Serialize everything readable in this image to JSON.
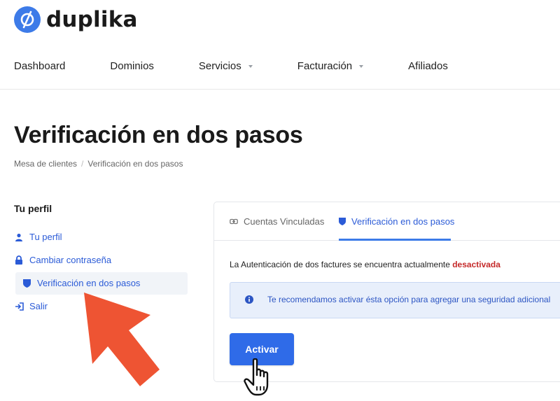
{
  "brand": {
    "name": "duplika",
    "color": "#3d7be8"
  },
  "nav": {
    "items": [
      {
        "label": "Dashboard",
        "has_dropdown": false
      },
      {
        "label": "Dominios",
        "has_dropdown": false
      },
      {
        "label": "Servicios",
        "has_dropdown": true
      },
      {
        "label": "Facturación",
        "has_dropdown": true
      },
      {
        "label": "Afiliados",
        "has_dropdown": false
      }
    ]
  },
  "page": {
    "title": "Verificación en dos pasos",
    "breadcrumb": [
      "Mesa de clientes",
      "/",
      "Verificación en dos pasos"
    ]
  },
  "sidebar": {
    "heading": "Tu perfil",
    "items": [
      {
        "label": "Tu perfil",
        "icon": "user-icon"
      },
      {
        "label": "Cambiar contraseña",
        "icon": "lock-icon"
      },
      {
        "label": "Verificación en dos pasos",
        "icon": "shield-icon",
        "active": true
      },
      {
        "label": "Salir",
        "icon": "logout-icon"
      }
    ]
  },
  "tabs": [
    {
      "label": "Cuentas Vinculadas",
      "icon": "link-icon",
      "active": false
    },
    {
      "label": "Verificación en dos pasos",
      "icon": "shield-icon",
      "active": true
    }
  ],
  "content": {
    "status_prefix": "La Autenticación de dos factures se encuentra actualmente ",
    "status_value": "desactivada",
    "alert_text": "Te recomendamos activar ésta opción para agregar una seguridad adicional",
    "activate_label": "Activar"
  },
  "colors": {
    "accent": "#2f6be8",
    "danger": "#c52a2a",
    "annotation_arrow": "#ee5433"
  }
}
